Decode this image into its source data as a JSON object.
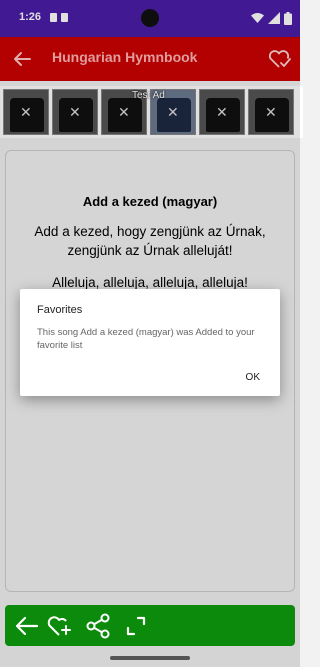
{
  "status_bar": {
    "time": "1:26"
  },
  "app_bar": {
    "title": "Hungarian Hymnbook"
  },
  "ad": {
    "label": "Test Ad"
  },
  "song": {
    "title": "Add a kezed (magyar)",
    "verse1_line1": "Add a kezed, hogy zengjünk az Úrnak,",
    "verse1_line2": "zengjünk az Úrnak alleluját!",
    "verse2_line1": "Alleluja, alleluja, alleluja, alleluja!"
  },
  "dialog": {
    "title": "Favorites",
    "message": "This song Add a kezed (magyar) was Added to your favorite list",
    "ok_label": "OK"
  },
  "colors": {
    "status_bar": "#4a1da8",
    "app_bar": "#cc0000",
    "bottom_bar": "#0b8a0b"
  },
  "icons": [
    "back-arrow-icon",
    "heart-check-icon",
    "wifi-icon",
    "signal-icon",
    "battery-icon",
    "add-favorite-icon",
    "share-icon",
    "fullscreen-icon"
  ]
}
